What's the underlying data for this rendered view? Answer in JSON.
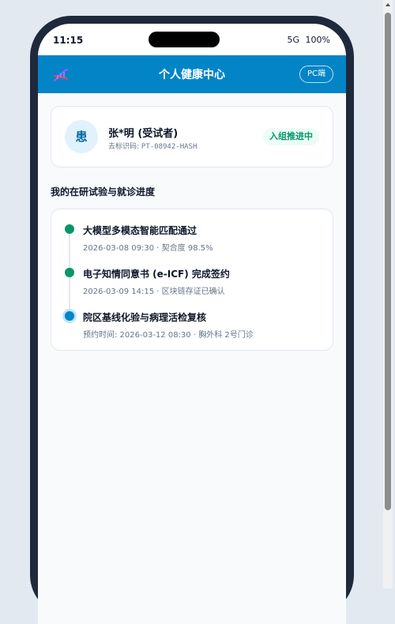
{
  "status_bar": {
    "time": "11:15",
    "network": "5G",
    "battery": "100%"
  },
  "header": {
    "logo_icon": "dna-icon",
    "title": "个人健康中心",
    "pc_button": "PC端"
  },
  "patient": {
    "avatar_text": "患",
    "name": "张*明 (受试者)",
    "id_label": "去标识码:",
    "id_code": "PT-08942-HASH",
    "status_badge": "入组推进中"
  },
  "timeline": {
    "section_title": "我的在研试验与就诊进度",
    "items": [
      {
        "title": "大模型多模态智能匹配通过",
        "meta": "2026-03-08 09:30 · 契合度 98.5%",
        "status": "done"
      },
      {
        "title": "电子知情同意书 (e-ICF) 完成签约",
        "meta": "2026-03-09 14:15 · 区块链存证已确认",
        "status": "done"
      },
      {
        "title": "院区基线化验与病理活检复核",
        "meta": "预约时间: 2026-03-12 08:30 · 胸外科 2号门诊",
        "status": "current"
      }
    ]
  },
  "colors": {
    "brand": "#0284c7",
    "done": "#059669",
    "current": "#0284c7",
    "frame": "#1e293b"
  }
}
